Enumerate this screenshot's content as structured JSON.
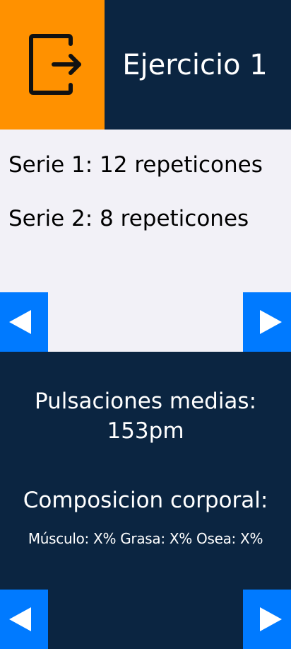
{
  "header": {
    "exit_icon": "exit-door-arrow-icon",
    "title": "Ejercicio 1"
  },
  "sets": [
    {
      "text": "Serie 1: 12 repeticones"
    },
    {
      "text": "Serie 2: 8 repeticones"
    }
  ],
  "stats": {
    "pulse_label": "Pulsaciones medias:",
    "pulse_value": "153pm",
    "composition_label": "Composicion corporal:",
    "composition_values": "Músculo: X% Grasa: X% Osea: X%"
  },
  "nav": {
    "prev_icon": "triangle-left-icon",
    "next_icon": "triangle-right-icon"
  },
  "colors": {
    "navy": "#0b2541",
    "orange": "#ff9100",
    "blue": "#007aff",
    "panel": "#f2f1f7"
  }
}
